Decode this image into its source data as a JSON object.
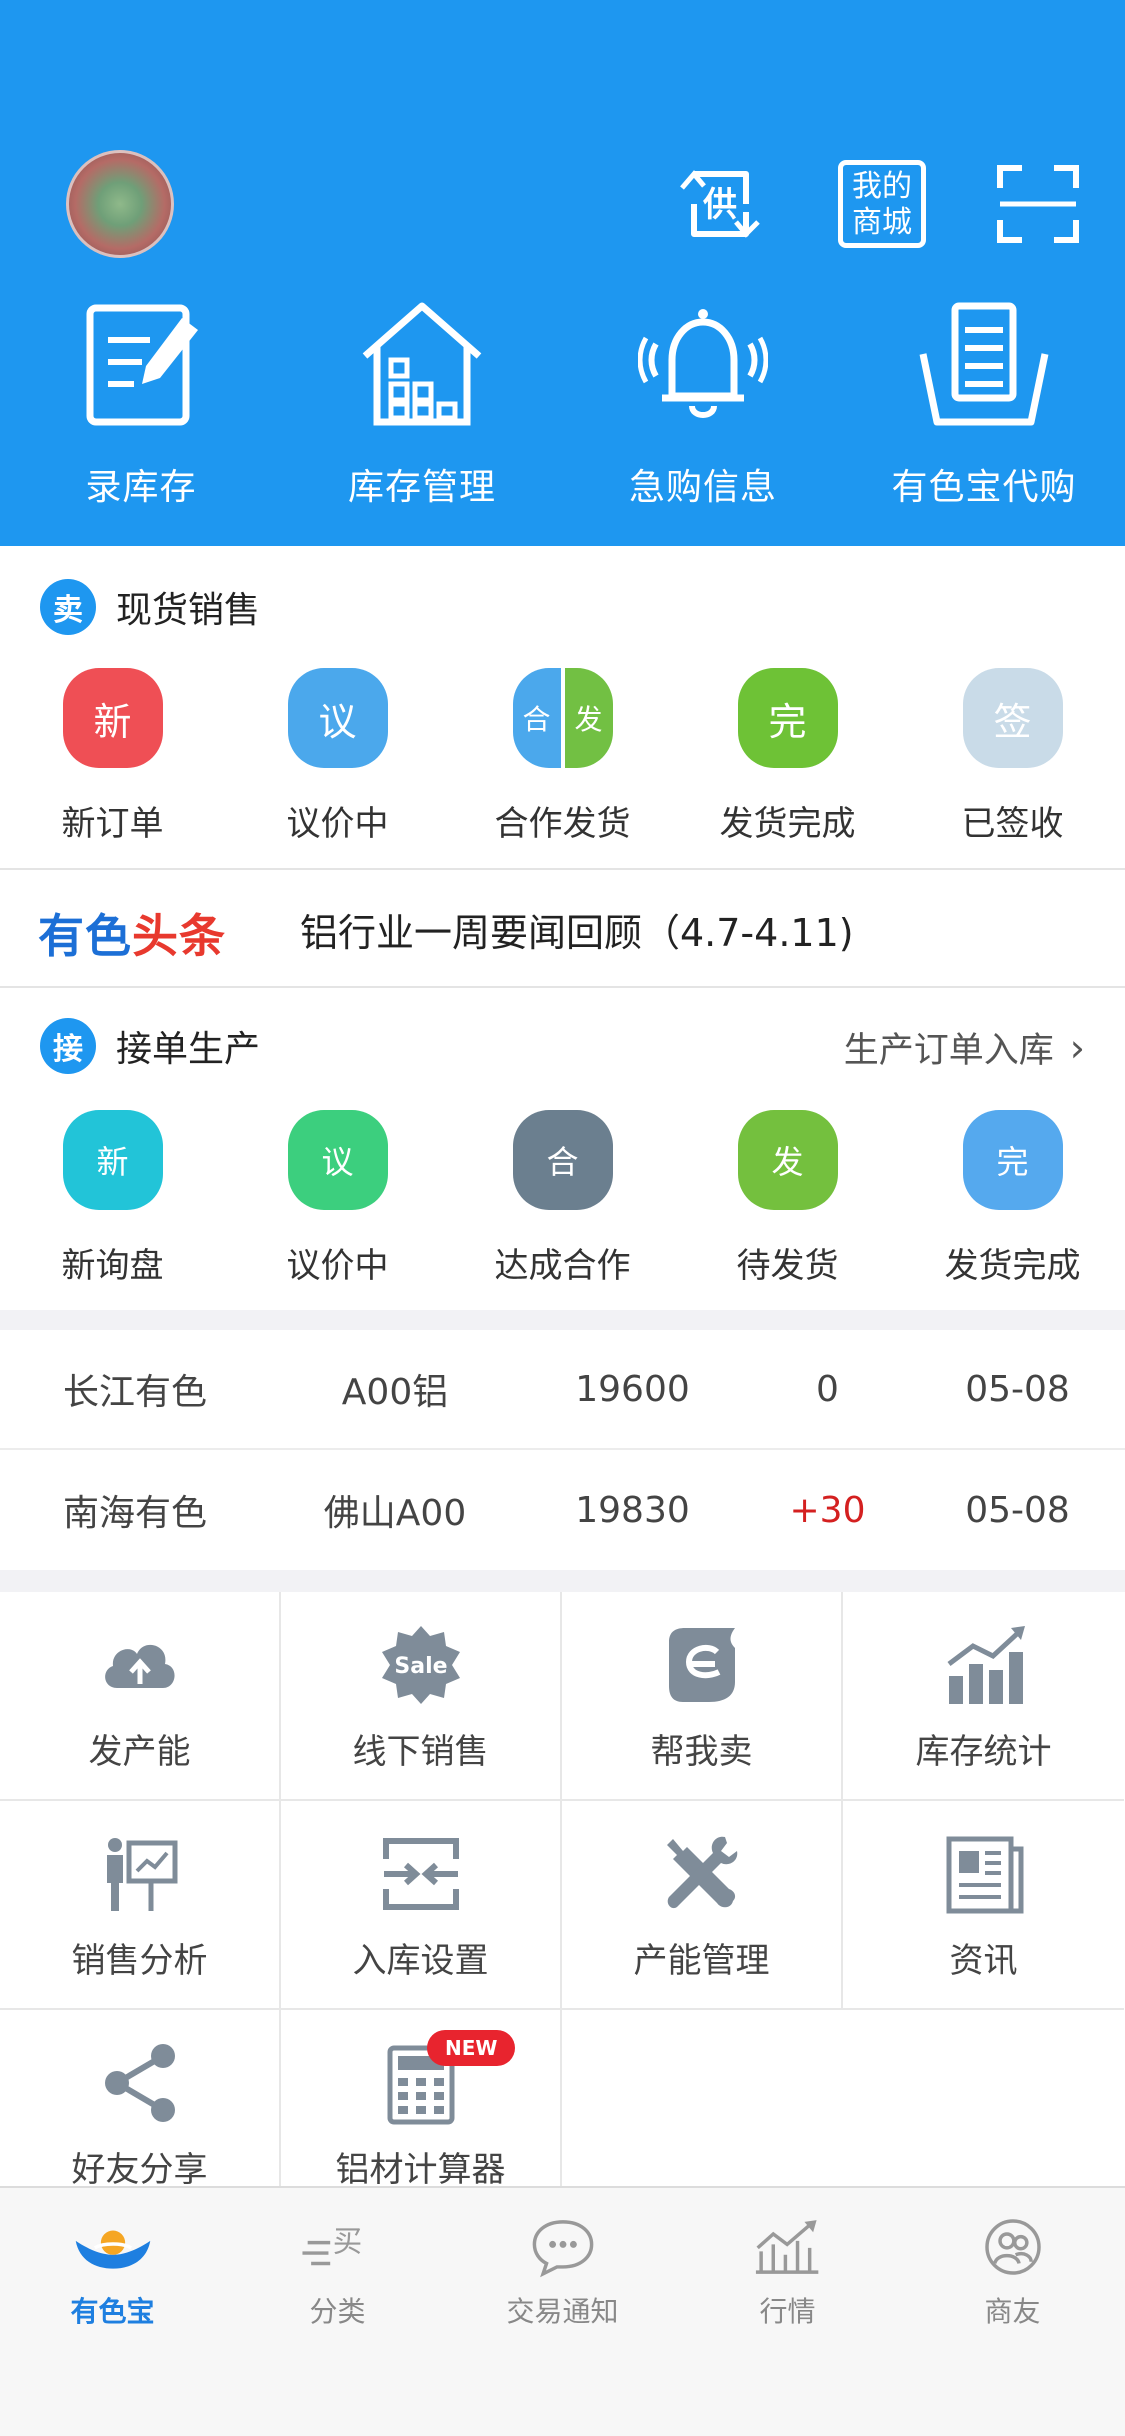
{
  "header": {
    "avatar_label": "",
    "icons": [
      "supply-icon",
      "my-mall-icon",
      "scan-icon"
    ],
    "supply_char": "供",
    "my_mall_line1": "我的",
    "my_mall_line2": "商城",
    "quick_actions": [
      {
        "label": "录库存",
        "icon": "edit-document-icon"
      },
      {
        "label": "库存管理",
        "icon": "warehouse-icon"
      },
      {
        "label": "急购信息",
        "icon": "bell-icon"
      },
      {
        "label": "有色宝代购",
        "icon": "basket-icon"
      }
    ]
  },
  "spot_sales": {
    "badge": "卖",
    "title": "现货销售",
    "items": [
      {
        "bubble": "新",
        "label": "新订单",
        "color": "#ef4f55"
      },
      {
        "bubble": "议",
        "label": "议价中",
        "color": "#4ba8ec"
      },
      {
        "bubble_left": "合",
        "bubble_right": "发",
        "label": "合作发货",
        "color_left": "#4ba8ec",
        "color_right": "#72c043"
      },
      {
        "bubble": "完",
        "label": "发货完成",
        "color": "#6ec236"
      },
      {
        "bubble": "签",
        "label": "已签收",
        "color": "#c9dbe8"
      }
    ]
  },
  "news": {
    "brand_blue": "有色",
    "brand_red": "头条",
    "headline": "铝行业一周要闻回顾（4.7-4.11)"
  },
  "production": {
    "badge": "接",
    "title": "接单生产",
    "link": "生产订单入库",
    "items": [
      {
        "bubble": "新",
        "label": "新询盘",
        "color": "#22c4d8"
      },
      {
        "bubble": "议",
        "label": "议价中",
        "color": "#3ccf7e"
      },
      {
        "bubble": "合",
        "label": "达成合作",
        "color": "#6b7f8f"
      },
      {
        "bubble": "发",
        "label": "待发货",
        "color": "#74c03e"
      },
      {
        "bubble": "完",
        "label": "发货完成",
        "color": "#55a9ee"
      }
    ]
  },
  "prices": [
    {
      "market": "长江有色",
      "product": "A00铝",
      "price": "19600",
      "change": "0",
      "date": "05-08",
      "change_color": "#444444"
    },
    {
      "market": "南海有色",
      "product": "佛山A00",
      "price": "19830",
      "change": "+30",
      "date": "05-08",
      "change_color": "#d42020"
    }
  ],
  "tools": [
    {
      "label": "发产能",
      "icon": "cloud-upload-icon"
    },
    {
      "label": "线下销售",
      "icon": "sale-badge-icon",
      "icon_text": "Sale"
    },
    {
      "label": "帮我卖",
      "icon": "help-sell-icon"
    },
    {
      "label": "库存统计",
      "icon": "bar-chart-icon"
    },
    {
      "label": "销售分析",
      "icon": "presentation-icon"
    },
    {
      "label": "入库设置",
      "icon": "inbound-icon"
    },
    {
      "label": "产能管理",
      "icon": "tools-icon"
    },
    {
      "label": "资讯",
      "icon": "newspaper-icon"
    },
    {
      "label": "好友分享",
      "icon": "share-icon"
    },
    {
      "label": "铝材计算器",
      "icon": "calculator-icon",
      "badge": "NEW"
    }
  ],
  "tabbar": [
    {
      "label": "有色宝",
      "icon": "handshake-icon",
      "active": true
    },
    {
      "label": "分类",
      "icon": "category-icon",
      "icon_text": "买",
      "active": false
    },
    {
      "label": "交易通知",
      "icon": "chat-icon",
      "active": false
    },
    {
      "label": "行情",
      "icon": "trend-icon",
      "active": false
    },
    {
      "label": "商友",
      "icon": "friends-icon",
      "active": false
    }
  ],
  "colors": {
    "primary": "#1e97f0",
    "accent_red": "#d42020",
    "icon_gray": "#7f8c99"
  }
}
